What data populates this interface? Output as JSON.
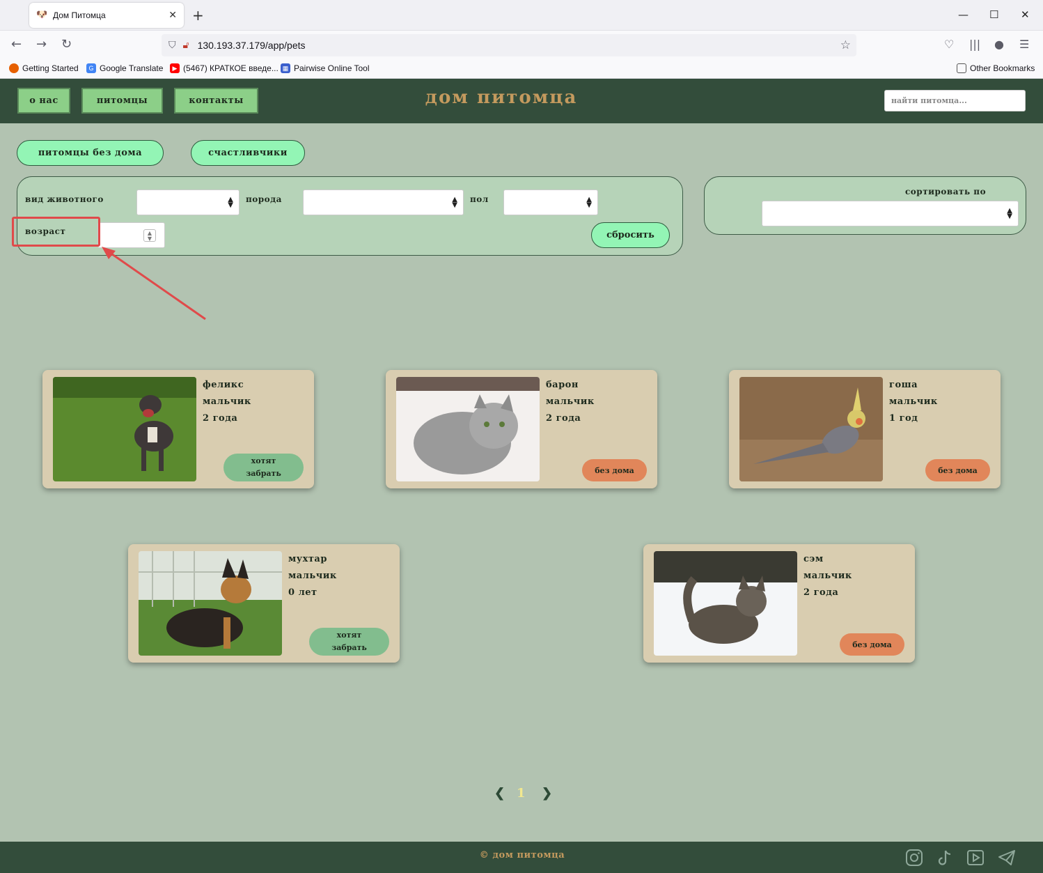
{
  "browser": {
    "tab_title": "Дом Питомца",
    "url": "130.193.37.179/app/pets",
    "bookmarks": [
      "Getting Started",
      "Google Translate",
      "(5467) КРАТКОЕ введе...",
      "Pairwise Online Tool"
    ],
    "other_bookmarks": "Other Bookmarks"
  },
  "header": {
    "nav": [
      "о нас",
      "питомцы",
      "контакты"
    ],
    "title": "дом питомца",
    "search_placeholder": "найти питомца..."
  },
  "filters": {
    "tabs": [
      "питомцы без дома",
      "счастливчики"
    ],
    "animal_label": "вид животного",
    "breed_label": "порода",
    "gender_label": "пол",
    "age_label": "возраст",
    "reset_label": "сбросить",
    "sort_label": "сортировать по"
  },
  "pets": [
    {
      "name": "феликс",
      "gender": "мальчик",
      "age": "2 года",
      "status": "хотят забрать",
      "status_type": "green",
      "photo": "dog-icon"
    },
    {
      "name": "барон",
      "gender": "мальчик",
      "age": "2 года",
      "status": "без дома",
      "status_type": "orange",
      "photo": "cat-icon"
    },
    {
      "name": "гоша",
      "gender": "мальчик",
      "age": "1 год",
      "status": "без дома",
      "status_type": "orange",
      "photo": "parrot-icon"
    },
    {
      "name": "мухтар",
      "gender": "мальчик",
      "age": "0 лет",
      "status": "хотят забрать",
      "status_type": "green",
      "photo": "puppy-icon"
    },
    {
      "name": "сэм",
      "gender": "мальчик",
      "age": "2 года",
      "status": "без дома",
      "status_type": "orange",
      "photo": "cat-icon"
    }
  ],
  "pagination": {
    "prev": "❮",
    "current": "1",
    "next": "❯"
  },
  "footer": {
    "copyright": "© дом питомца"
  },
  "colors": {
    "header": "#334d3b",
    "page": "#b2c3b1",
    "card": "#d9cdb0",
    "accent": "#93f5b5",
    "orange": "#e1865a",
    "green_status": "#82bd8e",
    "title": "#c49a5e"
  }
}
